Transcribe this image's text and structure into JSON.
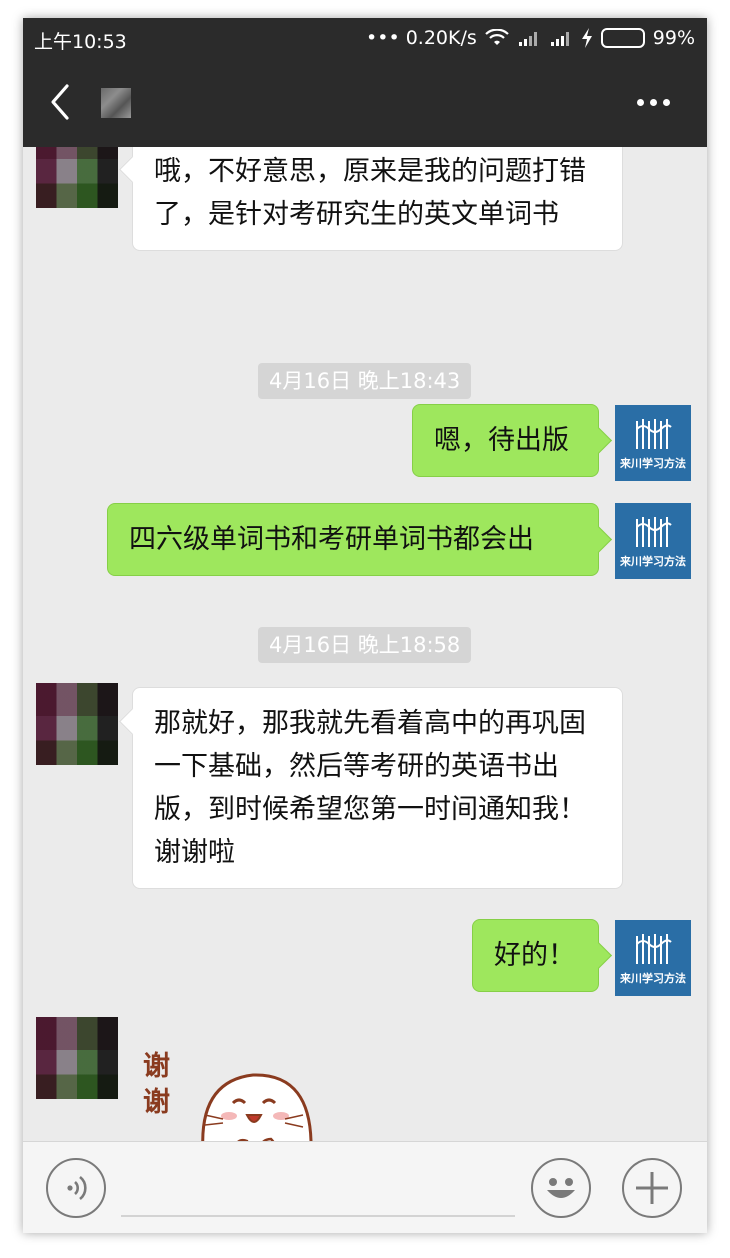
{
  "status_bar": {
    "time": "上午10:53",
    "net_speed": "••• 0.20K/s",
    "battery": "99%",
    "battery_level": 0.99
  },
  "header": {
    "back_icon": "chevron-left-icon",
    "more_icon": "more-dots-icon"
  },
  "contact_brand": "来川学习方法",
  "messages": [
    {
      "side": "left",
      "text": "哦，不好意思，原来是我的问题打错了，是针对考研究生的英文单词书"
    },
    {
      "type": "time",
      "text": "4月16日 晚上18:43"
    },
    {
      "side": "right",
      "text": "嗯，待出版"
    },
    {
      "side": "right",
      "text": "四六级单词书和考研单词书都会出"
    },
    {
      "type": "time",
      "text": "4月16日 晚上18:58"
    },
    {
      "side": "left",
      "text": "那就好，那我就先看着高中的再巩固一下基础，然后等考研的英语书出版，到时候希望您第一时间通知我！谢谢啦"
    },
    {
      "side": "right",
      "text": "好的！"
    },
    {
      "side": "left",
      "type": "sticker",
      "text": "谢谢"
    }
  ],
  "input_bar": {
    "voice_icon": "voice-icon",
    "emoji_icon": "emoji-icon",
    "plus_icon": "plus-icon"
  },
  "colors": {
    "header_bg": "#2b2b2b",
    "chat_bg": "#ebebeb",
    "bubble_sent": "#9ee75d",
    "bubble_received": "#ffffff",
    "avatar_brand": "#2a6ea6"
  }
}
